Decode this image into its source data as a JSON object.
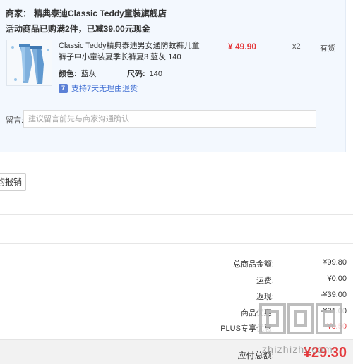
{
  "shop": {
    "name_label": "商家：",
    "name": "精典泰迪Classic Teddy童装旗舰店",
    "promo": "活动商品已购满2件，已减39.00元现金"
  },
  "product": {
    "title": "Classic Teddy精典泰迪男女通防蚊裤儿童裤子中小童装夏季长裤夏3 蓝灰 140",
    "color_label": "颜色:",
    "color": "蓝灰",
    "size_label": "尺码:",
    "size": "140",
    "return_icon": "7",
    "return_policy": "支持7天无理由退货",
    "price": "¥ 49.90",
    "quantity": "x2",
    "stock": "有货"
  },
  "remark": {
    "label": "留言:",
    "placeholder": "建议留言前先与商家沟通确认"
  },
  "invoice": {
    "button_label": "购报销"
  },
  "summary": {
    "rows": [
      {
        "label": "总商品金额:",
        "value": "¥99.80"
      },
      {
        "label": "运费:",
        "value": "¥0.00"
      },
      {
        "label": "返现:",
        "value": "-¥39.00"
      },
      {
        "label": "商品优惠:",
        "value": "-¥31.00"
      },
      {
        "label": "PLUS专享优惠:",
        "value": "-¥0.50"
      }
    ],
    "total_label": "应付总额:",
    "total": "¥29.30"
  },
  "watermark": {
    "text": "zhizhizhi.com"
  },
  "colors": {
    "accent_red": "#e4393c",
    "link_blue": "#3f6ed3",
    "panel_bg": "#f3f8fe"
  },
  "icons": [
    "product-thumbnail",
    "return-policy-icon",
    "watermark-logo"
  ]
}
